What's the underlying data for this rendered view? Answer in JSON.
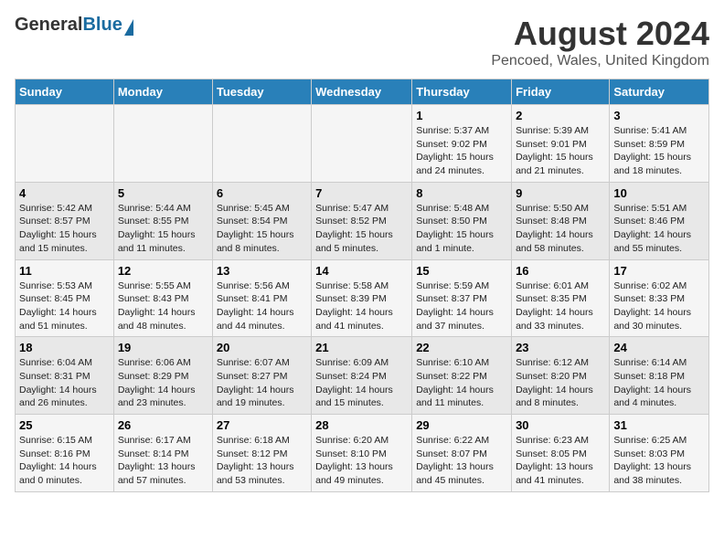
{
  "header": {
    "logo_general": "General",
    "logo_blue": "Blue",
    "month_year": "August 2024",
    "location": "Pencoed, Wales, United Kingdom"
  },
  "weekdays": [
    "Sunday",
    "Monday",
    "Tuesday",
    "Wednesday",
    "Thursday",
    "Friday",
    "Saturday"
  ],
  "weeks": [
    [
      {
        "day": "",
        "info": ""
      },
      {
        "day": "",
        "info": ""
      },
      {
        "day": "",
        "info": ""
      },
      {
        "day": "",
        "info": ""
      },
      {
        "day": "1",
        "info": "Sunrise: 5:37 AM\nSunset: 9:02 PM\nDaylight: 15 hours\nand 24 minutes."
      },
      {
        "day": "2",
        "info": "Sunrise: 5:39 AM\nSunset: 9:01 PM\nDaylight: 15 hours\nand 21 minutes."
      },
      {
        "day": "3",
        "info": "Sunrise: 5:41 AM\nSunset: 8:59 PM\nDaylight: 15 hours\nand 18 minutes."
      }
    ],
    [
      {
        "day": "4",
        "info": "Sunrise: 5:42 AM\nSunset: 8:57 PM\nDaylight: 15 hours\nand 15 minutes."
      },
      {
        "day": "5",
        "info": "Sunrise: 5:44 AM\nSunset: 8:55 PM\nDaylight: 15 hours\nand 11 minutes."
      },
      {
        "day": "6",
        "info": "Sunrise: 5:45 AM\nSunset: 8:54 PM\nDaylight: 15 hours\nand 8 minutes."
      },
      {
        "day": "7",
        "info": "Sunrise: 5:47 AM\nSunset: 8:52 PM\nDaylight: 15 hours\nand 5 minutes."
      },
      {
        "day": "8",
        "info": "Sunrise: 5:48 AM\nSunset: 8:50 PM\nDaylight: 15 hours\nand 1 minute."
      },
      {
        "day": "9",
        "info": "Sunrise: 5:50 AM\nSunset: 8:48 PM\nDaylight: 14 hours\nand 58 minutes."
      },
      {
        "day": "10",
        "info": "Sunrise: 5:51 AM\nSunset: 8:46 PM\nDaylight: 14 hours\nand 55 minutes."
      }
    ],
    [
      {
        "day": "11",
        "info": "Sunrise: 5:53 AM\nSunset: 8:45 PM\nDaylight: 14 hours\nand 51 minutes."
      },
      {
        "day": "12",
        "info": "Sunrise: 5:55 AM\nSunset: 8:43 PM\nDaylight: 14 hours\nand 48 minutes."
      },
      {
        "day": "13",
        "info": "Sunrise: 5:56 AM\nSunset: 8:41 PM\nDaylight: 14 hours\nand 44 minutes."
      },
      {
        "day": "14",
        "info": "Sunrise: 5:58 AM\nSunset: 8:39 PM\nDaylight: 14 hours\nand 41 minutes."
      },
      {
        "day": "15",
        "info": "Sunrise: 5:59 AM\nSunset: 8:37 PM\nDaylight: 14 hours\nand 37 minutes."
      },
      {
        "day": "16",
        "info": "Sunrise: 6:01 AM\nSunset: 8:35 PM\nDaylight: 14 hours\nand 33 minutes."
      },
      {
        "day": "17",
        "info": "Sunrise: 6:02 AM\nSunset: 8:33 PM\nDaylight: 14 hours\nand 30 minutes."
      }
    ],
    [
      {
        "day": "18",
        "info": "Sunrise: 6:04 AM\nSunset: 8:31 PM\nDaylight: 14 hours\nand 26 minutes."
      },
      {
        "day": "19",
        "info": "Sunrise: 6:06 AM\nSunset: 8:29 PM\nDaylight: 14 hours\nand 23 minutes."
      },
      {
        "day": "20",
        "info": "Sunrise: 6:07 AM\nSunset: 8:27 PM\nDaylight: 14 hours\nand 19 minutes."
      },
      {
        "day": "21",
        "info": "Sunrise: 6:09 AM\nSunset: 8:24 PM\nDaylight: 14 hours\nand 15 minutes."
      },
      {
        "day": "22",
        "info": "Sunrise: 6:10 AM\nSunset: 8:22 PM\nDaylight: 14 hours\nand 11 minutes."
      },
      {
        "day": "23",
        "info": "Sunrise: 6:12 AM\nSunset: 8:20 PM\nDaylight: 14 hours\nand 8 minutes."
      },
      {
        "day": "24",
        "info": "Sunrise: 6:14 AM\nSunset: 8:18 PM\nDaylight: 14 hours\nand 4 minutes."
      }
    ],
    [
      {
        "day": "25",
        "info": "Sunrise: 6:15 AM\nSunset: 8:16 PM\nDaylight: 14 hours\nand 0 minutes."
      },
      {
        "day": "26",
        "info": "Sunrise: 6:17 AM\nSunset: 8:14 PM\nDaylight: 13 hours\nand 57 minutes."
      },
      {
        "day": "27",
        "info": "Sunrise: 6:18 AM\nSunset: 8:12 PM\nDaylight: 13 hours\nand 53 minutes."
      },
      {
        "day": "28",
        "info": "Sunrise: 6:20 AM\nSunset: 8:10 PM\nDaylight: 13 hours\nand 49 minutes."
      },
      {
        "day": "29",
        "info": "Sunrise: 6:22 AM\nSunset: 8:07 PM\nDaylight: 13 hours\nand 45 minutes."
      },
      {
        "day": "30",
        "info": "Sunrise: 6:23 AM\nSunset: 8:05 PM\nDaylight: 13 hours\nand 41 minutes."
      },
      {
        "day": "31",
        "info": "Sunrise: 6:25 AM\nSunset: 8:03 PM\nDaylight: 13 hours\nand 38 minutes."
      }
    ]
  ]
}
